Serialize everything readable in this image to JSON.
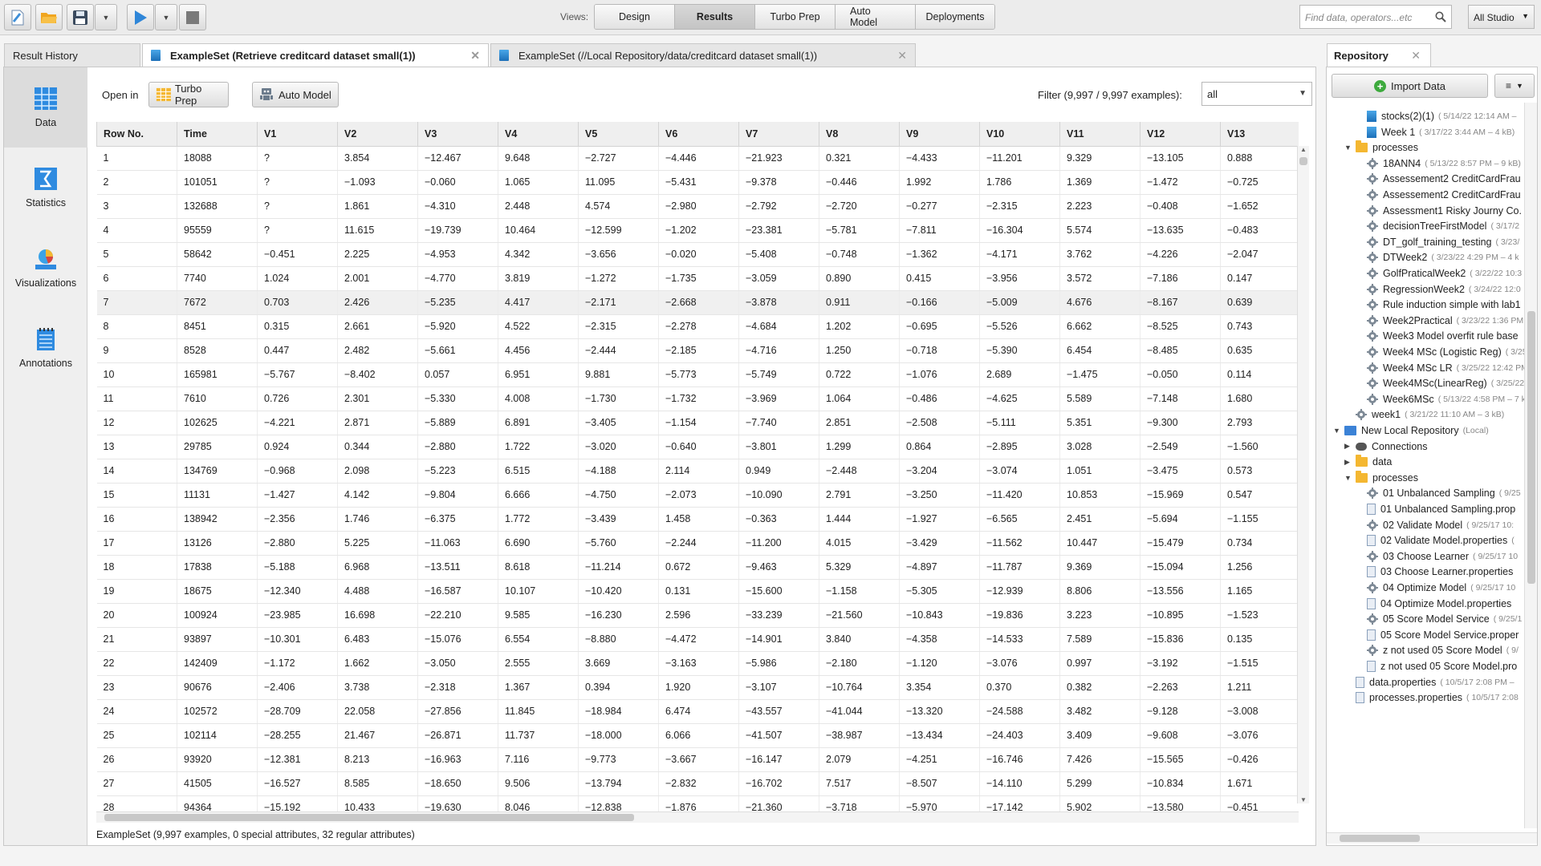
{
  "toolbar": {
    "views_label": "Views:",
    "tabs": [
      "Design",
      "Results",
      "Turbo Prep",
      "Auto Model",
      "Deployments"
    ],
    "search_placeholder": "Find data, operators...etc",
    "studio_label": "All Studio"
  },
  "panel_tabs": {
    "result_history": "Result History",
    "tab1": "ExampleSet (Retrieve creditcard dataset small(1))",
    "tab2": "ExampleSet (//Local Repository/data/creditcard dataset small(1))"
  },
  "sidebar": {
    "items": [
      "Data",
      "Statistics",
      "Visualizations",
      "Annotations"
    ]
  },
  "openin": {
    "label": "Open in",
    "turbo_prep": "Turbo Prep",
    "auto_model": "Auto Model",
    "filter_label": "Filter (9,997 / 9,997 examples):",
    "filter_value": "all"
  },
  "table": {
    "columns": [
      "Row No.",
      "Time",
      "V1",
      "V2",
      "V3",
      "V4",
      "V5",
      "V6",
      "V7",
      "V8",
      "V9",
      "V10",
      "V11",
      "V12",
      "V13"
    ],
    "rows": [
      [
        "1",
        "18088",
        "?",
        "3.854",
        "−12.467",
        "9.648",
        "−2.727",
        "−4.446",
        "−21.923",
        "0.321",
        "−4.433",
        "−11.201",
        "9.329",
        "−13.105",
        "0.888"
      ],
      [
        "2",
        "101051",
        "?",
        "−1.093",
        "−0.060",
        "1.065",
        "11.095",
        "−5.431",
        "−9.378",
        "−0.446",
        "1.992",
        "1.786",
        "1.369",
        "−1.472",
        "−0.725"
      ],
      [
        "3",
        "132688",
        "?",
        "1.861",
        "−4.310",
        "2.448",
        "4.574",
        "−2.980",
        "−2.792",
        "−2.720",
        "−0.277",
        "−2.315",
        "2.223",
        "−0.408",
        "−1.652"
      ],
      [
        "4",
        "95559",
        "?",
        "11.615",
        "−19.739",
        "10.464",
        "−12.599",
        "−1.202",
        "−23.381",
        "−5.781",
        "−7.811",
        "−16.304",
        "5.574",
        "−13.635",
        "−0.483"
      ],
      [
        "5",
        "58642",
        "−0.451",
        "2.225",
        "−4.953",
        "4.342",
        "−3.656",
        "−0.020",
        "−5.408",
        "−0.748",
        "−1.362",
        "−4.171",
        "3.762",
        "−4.226",
        "−2.047"
      ],
      [
        "6",
        "7740",
        "1.024",
        "2.001",
        "−4.770",
        "3.819",
        "−1.272",
        "−1.735",
        "−3.059",
        "0.890",
        "0.415",
        "−3.956",
        "3.572",
        "−7.186",
        "0.147"
      ],
      [
        "7",
        "7672",
        "0.703",
        "2.426",
        "−5.235",
        "4.417",
        "−2.171",
        "−2.668",
        "−3.878",
        "0.911",
        "−0.166",
        "−5.009",
        "4.676",
        "−8.167",
        "0.639"
      ],
      [
        "8",
        "8451",
        "0.315",
        "2.661",
        "−5.920",
        "4.522",
        "−2.315",
        "−2.278",
        "−4.684",
        "1.202",
        "−0.695",
        "−5.526",
        "6.662",
        "−8.525",
        "0.743"
      ],
      [
        "9",
        "8528",
        "0.447",
        "2.482",
        "−5.661",
        "4.456",
        "−2.444",
        "−2.185",
        "−4.716",
        "1.250",
        "−0.718",
        "−5.390",
        "6.454",
        "−8.485",
        "0.635"
      ],
      [
        "10",
        "165981",
        "−5.767",
        "−8.402",
        "0.057",
        "6.951",
        "9.881",
        "−5.773",
        "−5.749",
        "0.722",
        "−1.076",
        "2.689",
        "−1.475",
        "−0.050",
        "0.114"
      ],
      [
        "11",
        "7610",
        "0.726",
        "2.301",
        "−5.330",
        "4.008",
        "−1.730",
        "−1.732",
        "−3.969",
        "1.064",
        "−0.486",
        "−4.625",
        "5.589",
        "−7.148",
        "1.680"
      ],
      [
        "12",
        "102625",
        "−4.221",
        "2.871",
        "−5.889",
        "6.891",
        "−3.405",
        "−1.154",
        "−7.740",
        "2.851",
        "−2.508",
        "−5.111",
        "5.351",
        "−9.300",
        "2.793"
      ],
      [
        "13",
        "29785",
        "0.924",
        "0.344",
        "−2.880",
        "1.722",
        "−3.020",
        "−0.640",
        "−3.801",
        "1.299",
        "0.864",
        "−2.895",
        "3.028",
        "−2.549",
        "−1.560"
      ],
      [
        "14",
        "134769",
        "−0.968",
        "2.098",
        "−5.223",
        "6.515",
        "−4.188",
        "2.114",
        "0.949",
        "−2.448",
        "−3.204",
        "−3.074",
        "1.051",
        "−3.475",
        "0.573"
      ],
      [
        "15",
        "11131",
        "−1.427",
        "4.142",
        "−9.804",
        "6.666",
        "−4.750",
        "−2.073",
        "−10.090",
        "2.791",
        "−3.250",
        "−11.420",
        "10.853",
        "−15.969",
        "0.547"
      ],
      [
        "16",
        "138942",
        "−2.356",
        "1.746",
        "−6.375",
        "1.772",
        "−3.439",
        "1.458",
        "−0.363",
        "1.444",
        "−1.927",
        "−6.565",
        "2.451",
        "−5.694",
        "−1.155"
      ],
      [
        "17",
        "13126",
        "−2.880",
        "5.225",
        "−11.063",
        "6.690",
        "−5.760",
        "−2.244",
        "−11.200",
        "4.015",
        "−3.429",
        "−11.562",
        "10.447",
        "−15.479",
        "0.734"
      ],
      [
        "18",
        "17838",
        "−5.188",
        "6.968",
        "−13.511",
        "8.618",
        "−11.214",
        "0.672",
        "−9.463",
        "5.329",
        "−4.897",
        "−11.787",
        "9.369",
        "−15.094",
        "1.256"
      ],
      [
        "19",
        "18675",
        "−12.340",
        "4.488",
        "−16.587",
        "10.107",
        "−10.420",
        "0.131",
        "−15.600",
        "−1.158",
        "−5.305",
        "−12.939",
        "8.806",
        "−13.556",
        "1.165"
      ],
      [
        "20",
        "100924",
        "−23.985",
        "16.698",
        "−22.210",
        "9.585",
        "−16.230",
        "2.596",
        "−33.239",
        "−21.560",
        "−10.843",
        "−19.836",
        "3.223",
        "−10.895",
        "−1.523"
      ],
      [
        "21",
        "93897",
        "−10.301",
        "6.483",
        "−15.076",
        "6.554",
        "−8.880",
        "−4.472",
        "−14.901",
        "3.840",
        "−4.358",
        "−14.533",
        "7.589",
        "−15.836",
        "0.135"
      ],
      [
        "22",
        "142409",
        "−1.172",
        "1.662",
        "−3.050",
        "2.555",
        "3.669",
        "−3.163",
        "−5.986",
        "−2.180",
        "−1.120",
        "−3.076",
        "0.997",
        "−3.192",
        "−1.515"
      ],
      [
        "23",
        "90676",
        "−2.406",
        "3.738",
        "−2.318",
        "1.367",
        "0.394",
        "1.920",
        "−3.107",
        "−10.764",
        "3.354",
        "0.370",
        "0.382",
        "−2.263",
        "1.211"
      ],
      [
        "24",
        "102572",
        "−28.709",
        "22.058",
        "−27.856",
        "11.845",
        "−18.984",
        "6.474",
        "−43.557",
        "−41.044",
        "−13.320",
        "−24.588",
        "3.482",
        "−9.128",
        "−3.008"
      ],
      [
        "25",
        "102114",
        "−28.255",
        "21.467",
        "−26.871",
        "11.737",
        "−18.000",
        "6.066",
        "−41.507",
        "−38.987",
        "−13.434",
        "−24.403",
        "3.409",
        "−9.608",
        "−3.076"
      ],
      [
        "26",
        "93920",
        "−12.381",
        "8.213",
        "−16.963",
        "7.116",
        "−9.773",
        "−3.667",
        "−16.147",
        "2.079",
        "−4.251",
        "−16.746",
        "7.426",
        "−15.565",
        "−0.426"
      ],
      [
        "27",
        "41505",
        "−16.527",
        "8.585",
        "−18.650",
        "9.506",
        "−13.794",
        "−2.832",
        "−16.702",
        "7.517",
        "−8.507",
        "−14.110",
        "5.299",
        "−10.834",
        "1.671"
      ],
      [
        "28",
        "94364",
        "−15.192",
        "10.433",
        "−19.630",
        "8.046",
        "−12.838",
        "−1.876",
        "−21.360",
        "−3.718",
        "−5.970",
        "−17.142",
        "5.902",
        "−13.580",
        "−0.451"
      ]
    ]
  },
  "status": "ExampleSet (9,997 examples, 0 special attributes, 32 regular attributes)",
  "repository": {
    "title": "Repository",
    "import_label": "Import Data",
    "nodes": [
      {
        "indent": 1,
        "type": "data",
        "label": "stocks(2)(1)",
        "meta": "( 5/14/22 12:14 AM –"
      },
      {
        "indent": 1,
        "type": "data",
        "label": "Week 1",
        "meta": "( 3/17/22 3:44 AM – 4 kB)"
      },
      {
        "indent": 0,
        "type": "folder",
        "twist": "open",
        "label": "processes",
        "meta": ""
      },
      {
        "indent": 1,
        "type": "proc",
        "label": "18ANN4",
        "meta": "( 5/13/22 8:57 PM – 9 kB)"
      },
      {
        "indent": 1,
        "type": "proc",
        "label": "Assessement2 CreditCardFrau",
        "meta": ""
      },
      {
        "indent": 1,
        "type": "proc",
        "label": "Assessement2 CreditCardFrau",
        "meta": ""
      },
      {
        "indent": 1,
        "type": "proc",
        "label": "Assessment1 Risky Journy Co.",
        "meta": ""
      },
      {
        "indent": 1,
        "type": "proc",
        "label": "decisionTreeFirstModel",
        "meta": "( 3/17/2"
      },
      {
        "indent": 1,
        "type": "proc",
        "label": "DT_golf_training_testing",
        "meta": "( 3/23/"
      },
      {
        "indent": 1,
        "type": "proc",
        "label": "DTWeek2",
        "meta": "( 3/23/22 4:29 PM – 4 k"
      },
      {
        "indent": 1,
        "type": "proc",
        "label": "GolfPraticalWeek2",
        "meta": "( 3/22/22 10:3"
      },
      {
        "indent": 1,
        "type": "proc",
        "label": "RegressionWeek2",
        "meta": "( 3/24/22 12:0"
      },
      {
        "indent": 1,
        "type": "proc",
        "label": "Rule induction simple with lab1",
        "meta": ""
      },
      {
        "indent": 1,
        "type": "proc",
        "label": "Week2Practical",
        "meta": "( 3/23/22 1:36 PM"
      },
      {
        "indent": 1,
        "type": "proc",
        "label": "Week3 Model overfit rule base",
        "meta": ""
      },
      {
        "indent": 1,
        "type": "proc",
        "label": "Week4 MSc (Logistic Reg)",
        "meta": "( 3/25"
      },
      {
        "indent": 1,
        "type": "proc",
        "label": "Week4 MSc LR",
        "meta": "( 3/25/22 12:42 PM"
      },
      {
        "indent": 1,
        "type": "proc",
        "label": "Week4MSc(LinearReg)",
        "meta": "( 3/25/22"
      },
      {
        "indent": 1,
        "type": "proc",
        "label": "Week6MSc",
        "meta": "( 5/13/22 4:58 PM – 7 k"
      },
      {
        "indent": 0,
        "type": "proc",
        "label": "week1",
        "meta": "( 3/21/22 11:10 AM – 3 kB)"
      },
      {
        "indent": -1,
        "type": "repo",
        "twist": "open",
        "label": "New Local Repository",
        "meta": "(Local)"
      },
      {
        "indent": 0,
        "type": "conn",
        "twist": "closed",
        "label": "Connections",
        "meta": ""
      },
      {
        "indent": 0,
        "type": "folder",
        "twist": "closed",
        "label": "data",
        "meta": ""
      },
      {
        "indent": 0,
        "type": "folder",
        "twist": "open",
        "label": "processes",
        "meta": ""
      },
      {
        "indent": 1,
        "type": "proc",
        "label": "01 Unbalanced Sampling",
        "meta": "( 9/25"
      },
      {
        "indent": 1,
        "type": "file",
        "label": "01 Unbalanced Sampling.prop",
        "meta": ""
      },
      {
        "indent": 1,
        "type": "proc",
        "label": "02 Validate Model",
        "meta": "( 9/25/17 10:"
      },
      {
        "indent": 1,
        "type": "file",
        "label": "02 Validate Model.properties",
        "meta": "("
      },
      {
        "indent": 1,
        "type": "proc",
        "label": "03 Choose Learner",
        "meta": "( 9/25/17 10"
      },
      {
        "indent": 1,
        "type": "file",
        "label": "03 Choose Learner.properties",
        "meta": ""
      },
      {
        "indent": 1,
        "type": "proc",
        "label": "04 Optimize Model",
        "meta": "( 9/25/17 10"
      },
      {
        "indent": 1,
        "type": "file",
        "label": "04 Optimize Model.properties",
        "meta": ""
      },
      {
        "indent": 1,
        "type": "proc",
        "label": "05 Score Model Service",
        "meta": "( 9/25/1"
      },
      {
        "indent": 1,
        "type": "file",
        "label": "05 Score Model Service.proper",
        "meta": ""
      },
      {
        "indent": 1,
        "type": "proc",
        "label": "z not used 05 Score Model",
        "meta": "( 9/"
      },
      {
        "indent": 1,
        "type": "file",
        "label": "z not used 05 Score Model.pro",
        "meta": ""
      },
      {
        "indent": 0,
        "type": "file",
        "label": "data.properties",
        "meta": "( 10/5/17 2:08 PM –"
      },
      {
        "indent": 0,
        "type": "file",
        "label": "processes.properties",
        "meta": "( 10/5/17 2:08"
      }
    ]
  },
  "colors": {
    "accent_blue": "#1c6fb8",
    "folder": "#f4b731",
    "import_green": "#3daa3d"
  }
}
